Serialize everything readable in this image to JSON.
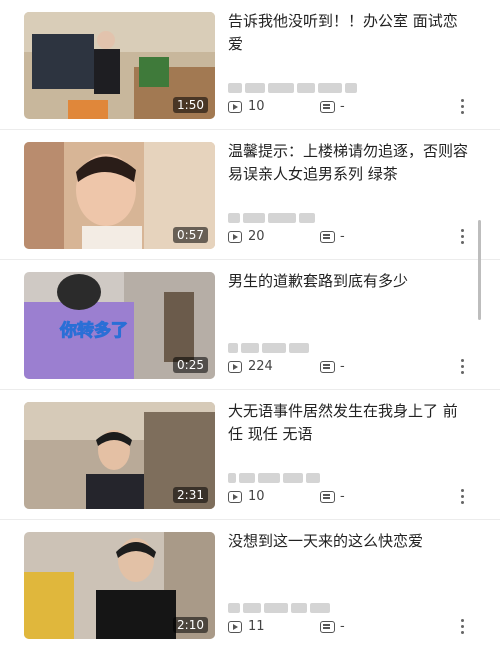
{
  "videos": [
    {
      "title": "告诉我他没听到！！办公室 面试恋爱",
      "duration": "1:50",
      "views": "10",
      "comments": "-",
      "overlay": ""
    },
    {
      "title": "温馨提示：上楼梯请勿追逐，否则容易误亲人女追男系列 绿茶",
      "duration": "0:57",
      "views": "20",
      "comments": "-",
      "overlay": ""
    },
    {
      "title": "男生的道歉套路到底有多少",
      "duration": "0:25",
      "views": "224",
      "comments": "-",
      "overlay": "你转多了"
    },
    {
      "title": "大无语事件居然发生在我身上了 前任 现任 无语",
      "duration": "2:31",
      "views": "10",
      "comments": "-",
      "overlay": ""
    },
    {
      "title": "没想到这一天来的这么快恋爱",
      "duration": "2:10",
      "views": "11",
      "comments": "-",
      "overlay": ""
    }
  ],
  "icons": {
    "views": "play-icon",
    "comments": "comment-icon",
    "more": "more-vertical-icon"
  }
}
